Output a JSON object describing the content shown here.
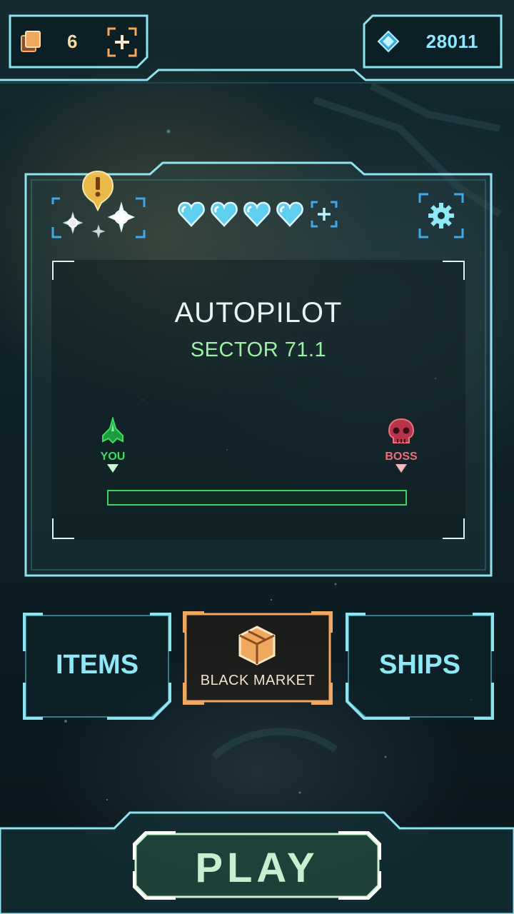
{
  "topbar": {
    "cards_count": "6",
    "gems_count": "28011"
  },
  "panel": {
    "lives": 4,
    "mode_title": "AUTOPILOT",
    "sector_label": "SECTOR 71.1",
    "you_label": "YOU",
    "boss_label": "BOSS",
    "progress_fraction": 0.0
  },
  "nav": {
    "items_label": "ITEMS",
    "market_label": "BLACK MARKET",
    "ships_label": "SHIPS"
  },
  "play_label": "PLAY",
  "icons": {
    "cards": "cards-stack-icon",
    "add": "plus-bracket-icon",
    "gem": "diamond-gem-icon",
    "missions": "crosshair-stars-icon",
    "alert": "exclamation-badge-icon",
    "life": "heart-icon",
    "settings": "gear-icon",
    "ship": "fighter-ship-icon",
    "boss": "skull-icon",
    "crate": "crate-icon"
  },
  "colors": {
    "frame": "#8fe3ef",
    "accent_orange": "#f0a860",
    "gem": "#8fe7ff",
    "you_green": "#3bdc62",
    "boss_red": "#ec6e7a",
    "progress_green": "#3bd463",
    "play_green": "#c9efd0"
  }
}
